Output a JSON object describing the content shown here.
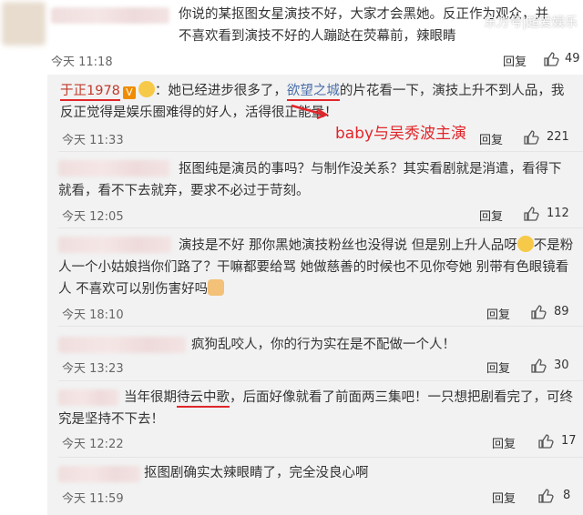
{
  "watermark": "东方号|超爱娱乐",
  "annotation": "baby与吴秀波主演",
  "comments": [
    {
      "text": "你说的某抠图女星演技不好，大家才会黑她。反正作为观众，并不喜欢看到演技不好的人蹦跶在荧幕前，辣眼睛",
      "time": "今天 11:18",
      "reply": "回复",
      "likes": "49"
    },
    {
      "user": "于正1978",
      "vbadge": "V",
      "text_pre": "：她已经进步很多了，",
      "link": "欲望之城",
      "text_post": "的片花看一下，演技上升不到人品，我反正觉得是娱乐圈难得的好人，活得很正能量！",
      "time": "今天 11:33",
      "reply": "回复",
      "likes": "221"
    },
    {
      "text": "抠图纯是演员的事吗？与制作没关系？其实看剧就是消遣，看得下就看，看不下去就弃，要求不必过于苛刻。",
      "time": "今天 12:05",
      "reply": "回复",
      "likes": "112"
    },
    {
      "text_a": "演技是不好 那你黑她演技粉丝也没得说 但是别上升人品呀",
      "text_b": "不是粉 人一个小姑娘挡你们路了？干嘛都要给骂 她做慈善的时候也不见你夸她 别带有色眼镜看人 不喜欢可以别伤害好吗",
      "time": "今天 18:10",
      "reply": "回复",
      "likes": "89"
    },
    {
      "text": "疯狗乱咬人，你的行为实在是不配做一个人！",
      "time": "今天 13:23",
      "reply": "回复",
      "likes": "30"
    },
    {
      "text_pre": "当年很期",
      "link": "待云中歌",
      "text_post": "，后面好像就看了前面两三集吧！一只想把剧看完了，可终究是坚持不下去！",
      "time": "今天 12:22",
      "reply": "回复",
      "likes": "17"
    },
    {
      "text": "抠图剧确实太辣眼睛了，完全没良心啊",
      "time": "今天 11:59",
      "reply": "回复",
      "likes": "8"
    }
  ]
}
